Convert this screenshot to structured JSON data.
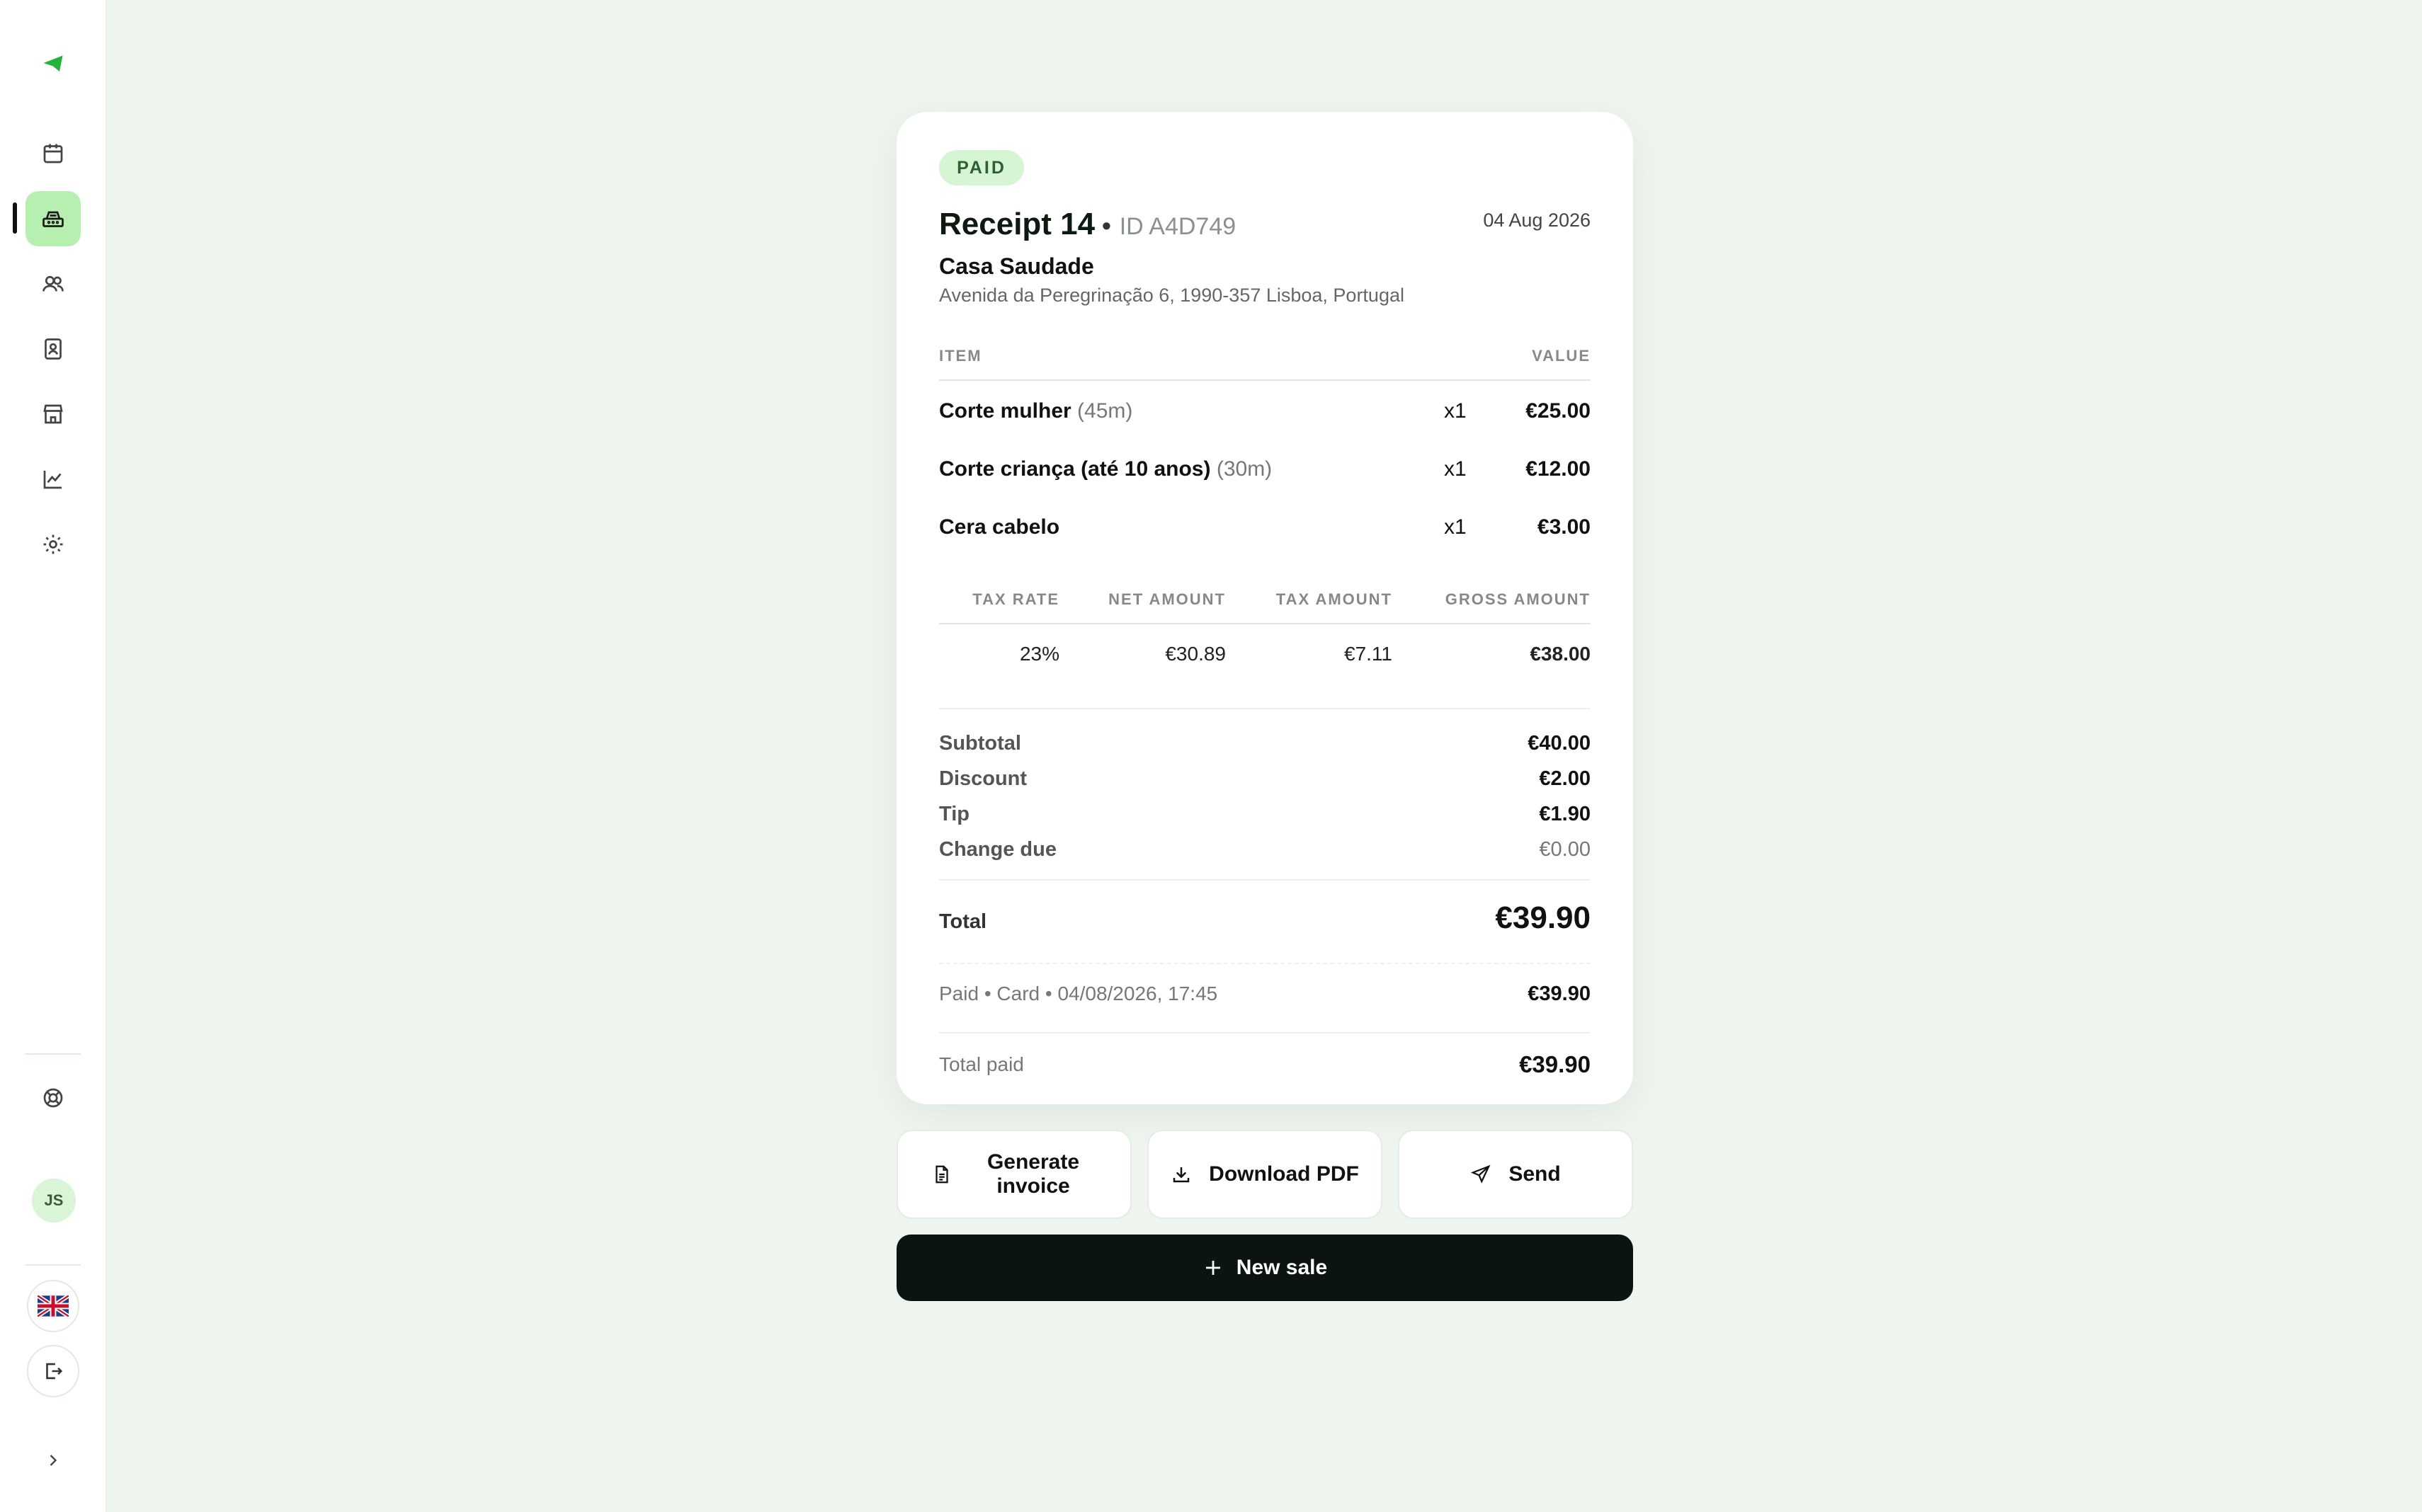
{
  "sidebar": {
    "nav": [
      {
        "name": "calendar",
        "icon": "calendar-icon"
      },
      {
        "name": "checkout",
        "icon": "cash-register-icon",
        "active": true
      },
      {
        "name": "clients",
        "icon": "users-icon"
      },
      {
        "name": "contacts",
        "icon": "contact-book-icon"
      },
      {
        "name": "store",
        "icon": "store-icon"
      },
      {
        "name": "reports",
        "icon": "chart-icon"
      },
      {
        "name": "settings",
        "icon": "gear-icon"
      }
    ],
    "avatar_initials": "JS",
    "language_icon": "uk-flag-icon"
  },
  "receipt": {
    "status": "PAID",
    "title": "Receipt 14",
    "separator": "•",
    "id": "ID A4D749",
    "date": "04 Aug 2026",
    "business_name": "Casa Saudade",
    "business_address": "Avenida da Peregrinação 6, 1990-357 Lisboa, Portugal",
    "col_item": "ITEM",
    "col_value": "VALUE",
    "items": [
      {
        "name": "Corte mulher",
        "duration": "(45m)",
        "qty": "x1",
        "value": "€25.00"
      },
      {
        "name": "Corte criança (até 10 anos)",
        "duration": "(30m)",
        "qty": "x1",
        "value": "€12.00"
      },
      {
        "name": "Cera cabelo",
        "duration": "",
        "qty": "x1",
        "value": "€3.00"
      }
    ],
    "tax": {
      "headers": [
        "TAX RATE",
        "NET AMOUNT",
        "TAX AMOUNT",
        "GROSS AMOUNT"
      ],
      "row": [
        "23%",
        "€30.89",
        "€7.11",
        "€38.00"
      ]
    },
    "summary": [
      {
        "label": "Subtotal",
        "value": "€40.00"
      },
      {
        "label": "Discount",
        "value": "€2.00"
      },
      {
        "label": "Tip",
        "value": "€1.90"
      },
      {
        "label": "Change due",
        "value": "€0.00"
      }
    ],
    "total_label": "Total",
    "total_value": "€39.90",
    "payment_label": "Paid • Card • 04/08/2026, 17:45",
    "payment_value": "€39.90",
    "total_paid_label": "Total paid",
    "total_paid_value": "€39.90"
  },
  "actions": {
    "generate_invoice": "Generate invoice",
    "download_pdf": "Download PDF",
    "send": "Send",
    "new_sale": "New sale"
  },
  "colors": {
    "accent": "#22b33a",
    "active_nav": "#b6efb0",
    "badge_bg": "#d6f5d4",
    "page_bg": "#eef4ee",
    "primary_button": "#0b1410"
  }
}
